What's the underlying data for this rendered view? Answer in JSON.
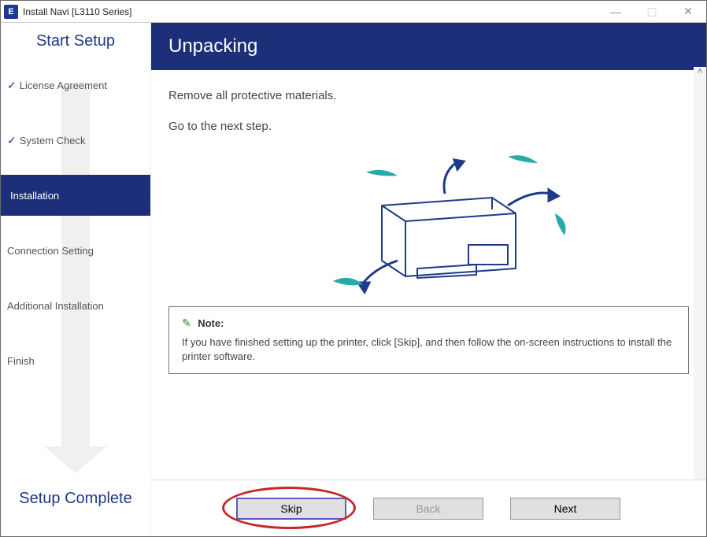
{
  "titlebar": {
    "icon_letter": "E",
    "title": "Install Navi [L3110 Series]"
  },
  "sidebar": {
    "header": "Start Setup",
    "footer": "Setup Complete",
    "steps": [
      {
        "label": "License Agreement",
        "done": true
      },
      {
        "label": "System Check",
        "done": true
      },
      {
        "label": "Installation",
        "active": true
      },
      {
        "label": "Connection Setting"
      },
      {
        "label": "Additional Installation"
      },
      {
        "label": "Finish"
      }
    ]
  },
  "main": {
    "heading": "Unpacking",
    "line1": "Remove all protective materials.",
    "line2": "Go to the next step.",
    "note_label": "Note:",
    "note_body": "If you have finished setting up the printer, click [Skip], and then follow the on-screen instructions to install the printer software."
  },
  "buttons": {
    "skip": "Skip",
    "back": "Back",
    "next": "Next"
  }
}
